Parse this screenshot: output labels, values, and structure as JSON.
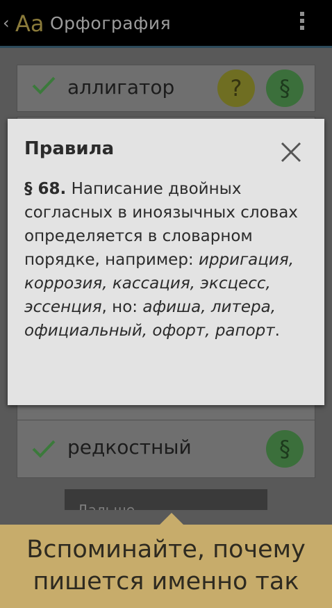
{
  "app_bar": {
    "back_glyph": "‹",
    "logo": "Aa",
    "title": "Орфография",
    "menu_icon": "overflow-menu-icon"
  },
  "list": {
    "items": [
      {
        "word": "аллигатор",
        "status": "correct",
        "buttons": [
          "?",
          "§"
        ]
      },
      {
        "word": "редкостный",
        "status": "correct",
        "buttons": [
          "§"
        ]
      }
    ],
    "next_button_label": "Дальше"
  },
  "dialog": {
    "title": "Правила",
    "rule_number": "§ 68.",
    "rule_text": "Написание двойных согласных в иноязычных словах определяется в словарном порядке, например:",
    "examples": "ирригация, коррозия, кассация, эксцесс, эссенция",
    "connector": ", но:",
    "exceptions": "афиша, литера, официальный, офорт, рапорт",
    "end": ".",
    "close_icon": "close-icon"
  },
  "promo": {
    "line1": "Вспоминайте, почему",
    "line2": "пишется именно так"
  },
  "colors": {
    "check": "#3b7a3b",
    "help_button": "#6f6e22",
    "rule_button": "#3b6f3b",
    "dialog_bg": "#e3e3e3",
    "banner_bg": "#c7ac6b"
  }
}
